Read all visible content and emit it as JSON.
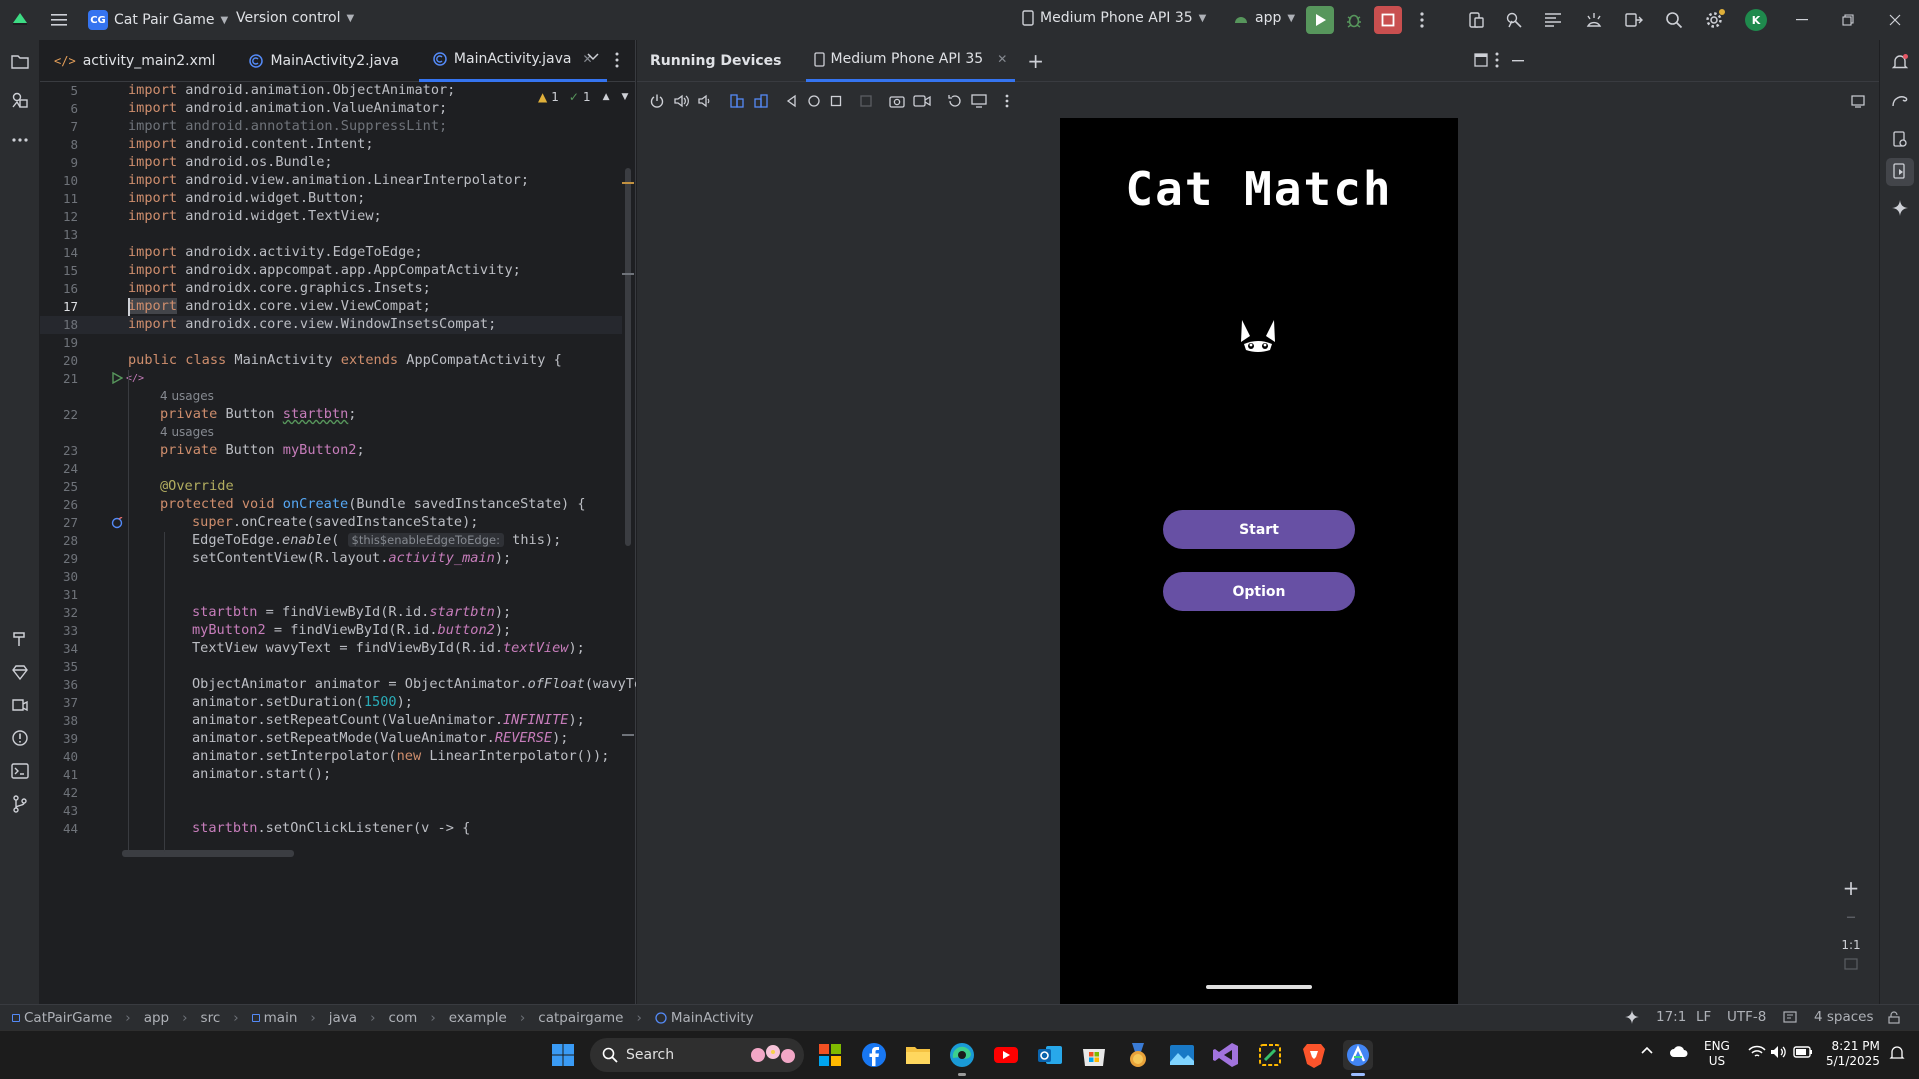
{
  "titlebar": {
    "project_badge": "CG",
    "project_name": "Cat Pair Game",
    "vcs": "Version control",
    "device": "Medium Phone API 35",
    "run_config": "app",
    "avatar": "K"
  },
  "editor": {
    "tabs": [
      {
        "label": "activity_main2.xml",
        "icon": "xml-icon"
      },
      {
        "label": "MainActivity2.java",
        "icon": "class-icon"
      },
      {
        "label": "MainActivity.java",
        "icon": "class-icon",
        "active": true
      }
    ],
    "inspection": {
      "warnings": "1",
      "ok": "1"
    },
    "usages_22": "4 usages",
    "usages_23": "4 usages",
    "param_hint": "$this$enableEdgeToEdge:",
    "line_numbers": [
      "5",
      "6",
      "7",
      "8",
      "9",
      "10",
      "11",
      "12",
      "13",
      "14",
      "15",
      "16",
      "17",
      "18",
      "19",
      "20",
      "21",
      "22",
      "23",
      "24",
      "25",
      "26",
      "27",
      "28",
      "29",
      "30",
      "31",
      "32",
      "33",
      "34",
      "35",
      "36",
      "37",
      "38",
      "39",
      "40",
      "41",
      "42",
      "43",
      "44"
    ],
    "code": {
      "l5": [
        "import",
        " android.animation.ObjectAnimator;"
      ],
      "l6": [
        "import",
        " android.animation.ValueAnimator;"
      ],
      "l7": "import android.annotation.SuppressLint;",
      "l8": [
        "import",
        " android.content.Intent;"
      ],
      "l9": [
        "import",
        " android.os.Bundle;"
      ],
      "l10": [
        "import",
        " android.view.animation.LinearInterpolator;"
      ],
      "l11": [
        "import",
        " android.widget.Button;"
      ],
      "l12": [
        "import",
        " android.widget.TextView;"
      ],
      "l14": [
        "import",
        " androidx.activity.EdgeToEdge;"
      ],
      "l15": [
        "import",
        " androidx.appcompat.app.AppCompatActivity;"
      ],
      "l16": [
        "import",
        " androidx.core.graphics.Insets;"
      ],
      "l17": [
        "import",
        " androidx.core.view.ViewCompat;"
      ],
      "l18": [
        "import",
        " androidx.core.view.WindowInsetsCompat;"
      ],
      "l20": [
        "public class",
        " MainActivity ",
        "extends",
        " AppCompatActivity {"
      ],
      "l22": [
        "private",
        " Button ",
        "startbtn",
        ";"
      ],
      "l23": [
        "private",
        " Button ",
        "myButton2",
        ";"
      ],
      "l25": "@Override",
      "l26": [
        "protected void",
        " ",
        "onCreate",
        "(Bundle savedInstanceState) {"
      ],
      "l27": [
        "super",
        ".onCreate(savedInstanceState);"
      ],
      "l28": [
        "EdgeToEdge.",
        "enable",
        "(",
        " this);"
      ],
      "l29": [
        "setContentView(R.layout.",
        "activity_main",
        ");"
      ],
      "l32": [
        "startbtn",
        " = findViewById(R.id.",
        "startbtn",
        ");"
      ],
      "l33": [
        "myButton2",
        " = findViewById(R.id.",
        "button2",
        ");"
      ],
      "l34": [
        "TextView wavyText = findViewById(R.id.",
        "textView",
        ");"
      ],
      "l36": [
        "ObjectAnimator animator = ObjectAnimator.",
        "ofFloat",
        "(wavyTex"
      ],
      "l37": [
        "animator.setDuration(",
        "1500",
        ");"
      ],
      "l38": [
        "animator.setRepeatCount(ValueAnimator.",
        "INFINITE",
        ");"
      ],
      "l39": [
        "animator.setRepeatMode(ValueAnimator.",
        "REVERSE",
        ");"
      ],
      "l40": [
        "animator.setInterpolator(",
        "new",
        " LinearInterpolator());"
      ],
      "l41": "animator.start();",
      "l44": [
        "startbtn",
        ".setOnClickListener(v -> {"
      ]
    }
  },
  "devices": {
    "title": "Running Devices",
    "tab": "Medium Phone API 35",
    "zoom_label": "1:1"
  },
  "app_screen": {
    "title": "Cat Match",
    "start_button": "Start",
    "option_button": "Option"
  },
  "statusbar": {
    "breadcrumb": [
      "CatPairGame",
      "app",
      "src",
      "main",
      "java",
      "com",
      "example",
      "catpairgame",
      "MainActivity"
    ],
    "position": "17:1",
    "line_sep": "LF",
    "encoding": "UTF-8",
    "indent": "4 spaces"
  },
  "taskbar": {
    "search": "Search",
    "lang1": "ENG",
    "lang2": "US",
    "time": "8:21 PM",
    "date": "5/1/2025"
  },
  "colors": {
    "accent": "#3574f0",
    "button_purple": "#6750a4",
    "run_green": "#57965c",
    "stop_red": "#c94f4f"
  }
}
